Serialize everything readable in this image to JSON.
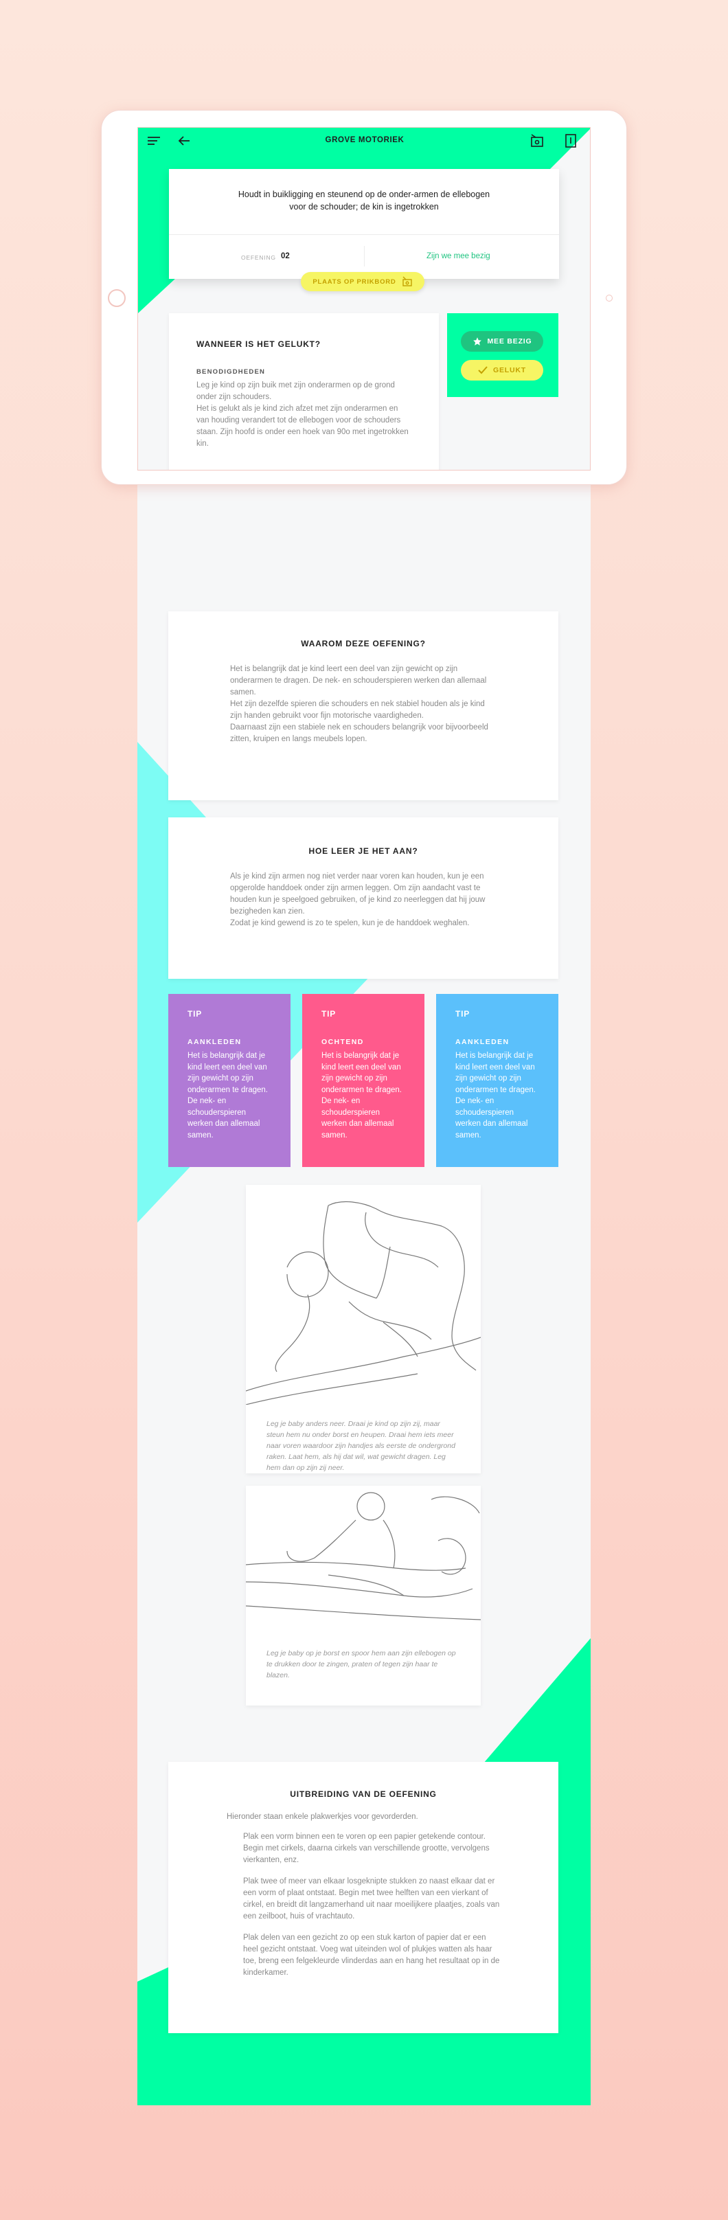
{
  "header": {
    "title": "GROVE MOTORIEK",
    "menu_icon": "hamburger-icon",
    "back_icon": "arrow-left-icon",
    "icon_right_1": "board-pin-icon",
    "icon_right_2": "document-icon"
  },
  "exercise": {
    "description": "Houdt in buikligging en steunend op de onder-armen de ellebogen voor de schouder; de kin is ingetrokken",
    "number_label": "OEFENING",
    "number_value": "02",
    "status_link": "Zijn we mee bezig",
    "pin_button": "PLAATS OP PRIKBORD"
  },
  "status_buttons": {
    "busy": "MEE BEZIG",
    "done": "GELUKT"
  },
  "success": {
    "title": "WANNEER IS HET GELUKT?",
    "subtitle": "BENODIGDHEDEN",
    "lines": [
      "Leg je kind op zijn buik met zijn onderarmen op de grond onder zijn schouders.",
      "Het is gelukt als je kind zich afzet met zijn onderarmen en van houding verandert tot de ellebogen voor de schouders staan. Zijn hoofd is onder een hoek van 90o met ingetrokken kin."
    ]
  },
  "why": {
    "title": "WAAROM DEZE OEFENING?",
    "lines": [
      "Het is belangrijk dat je kind leert een deel van zijn gewicht op zijn onderarmen te dragen. De nek- en schouderspieren werken dan allemaal samen.",
      "Het zijn dezelfde spieren die schouders en nek stabiel houden als je kind zijn handen gebruikt voor fijn motorische vaardigheden.",
      "Daarnaast zijn een stabiele nek en schouders belangrijk voor bijvoorbeeld zitten, kruipen en langs meubels lopen."
    ]
  },
  "how": {
    "title": "HOE LEER JE HET AAN?",
    "lines": [
      "Als je kind zijn armen nog niet verder naar voren kan houden, kun je een opgerolde handdoek onder zijn armen leggen. Om zijn aandacht vast te houden kun je speelgoed gebruiken, of je kind zo neerleggen dat hij jouw bezigheden kan zien.",
      "Zodat je kind gewend is zo te spelen, kun je de handdoek weghalen."
    ]
  },
  "tips": [
    {
      "label": "TIP",
      "category": "AANKLEDEN",
      "text": "Het is belangrijk dat je kind leert een deel van zijn gewicht op zijn onderarmen te dragen. De nek- en schouderspieren werken dan allemaal samen.",
      "color": "#b07ad6"
    },
    {
      "label": "TIP",
      "category": "OCHTEND",
      "text": "Het is belangrijk dat je kind leert een deel van zijn gewicht op zijn onderarmen te dragen. De nek- en schouderspieren werken dan allemaal samen.",
      "color": "#ff5a8c"
    },
    {
      "label": "TIP",
      "category": "AANKLEDEN",
      "text": "Het is belangrijk dat je kind leert een deel van zijn gewicht op zijn onderarmen te dragen. De nek- en schouderspieren werken dan allemaal samen.",
      "color": "#5bc0fb"
    }
  ],
  "illustrations": [
    {
      "caption": "Leg je baby anders neer. Draai je kind op zijn zij, maar steun hem nu onder borst en heupen. Draai hem iets meer naar voren waardoor zijn handjes als eerste de ondergrond raken. Laat hem, als hij dat wil, wat gewicht dragen. Leg hem dan op zijn zij neer."
    },
    {
      "caption": "Leg je baby op je borst en spoor hem aan zijn ellebogen op te drukken door te zingen, praten of tegen zijn haar te blazen."
    }
  ],
  "extension": {
    "title": "UITBREIDING VAN DE OEFENING",
    "intro": "Hieronder staan enkele plakwerkjes voor gevorderden.",
    "paragraphs": [
      "Plak een vorm binnen een te voren op een papier getekende contour. Begin met cirkels, daarna cirkels van verschillende grootte, vervolgens vierkanten, enz.",
      "Plak twee of meer van elkaar losgeknipte stukken zo naast elkaar dat er een vorm of plaat ontstaat. Begin met twee helften van een vierkant of cirkel, en breidt dit langzamerhand uit naar moeilijkere plaatjes, zoals van een zeilboot, huis of vrachtauto.",
      "Plak delen van een gezicht zo op een stuk karton of papier dat er een heel gezicht ontstaat. Voeg wat uiteinden wol of plukjes watten als haar toe, breng een felgekleurde vlinderdas aan en hang het resultaat op in de kinderkamer."
    ]
  },
  "colors": {
    "accent_green": "#00ffa3",
    "accent_cyan": "#7dfcf4",
    "pin_yellow": "#f6f564",
    "dark_green": "#1fc480"
  }
}
